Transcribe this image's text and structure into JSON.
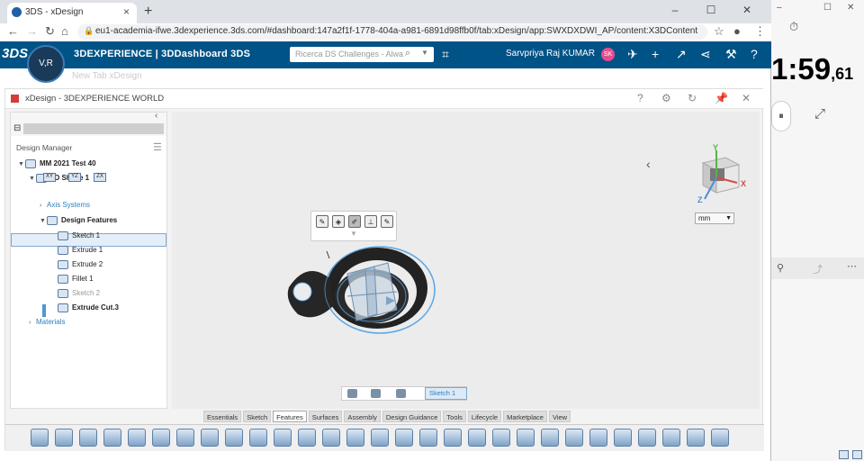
{
  "browser": {
    "tab_title": "3DS - xDesign",
    "tab_close": "×",
    "new_tab": "+",
    "url": "eu1-academia-ifwe.3dexperience.3ds.com/#dashboard:147a2f1f-1778-404a-a981-6891d98ffb0f/tab:xDesign/app:SWXDXDWI_AP/content:X3DContentId=%7B\"data\"%3A%7B\"i...",
    "window": {
      "minimize": "–",
      "maximize": "☐",
      "close": "✕"
    }
  },
  "dashboard": {
    "logo": "3DS",
    "title": "3DEXPERIENCE | 3DDashboard 3DS",
    "search_placeholder": "Ricerca DS Challenges - Always",
    "user_name": "Sarvpriya Raj KUMAR",
    "user_initials": "SK",
    "compass_label": "V,R"
  },
  "ghost_tabs": "New Tab     xDesign",
  "app": {
    "title": "xDesign - 3DEXPERIENCE WORLD"
  },
  "design_manager": {
    "label": "Design Manager",
    "tree": [
      {
        "label": "MM 2021 Test 40",
        "level": 0,
        "style": "bold"
      },
      {
        "label": "3D Shape 1",
        "level": 1,
        "style": "bold"
      },
      {
        "label": "Axis Systems",
        "level": 2,
        "style": "link"
      },
      {
        "label": "Design Features",
        "level": 2,
        "style": "bold"
      },
      {
        "label": "Sketch 1",
        "level": 3,
        "style": "normal"
      },
      {
        "label": "Extrude 1",
        "level": 3,
        "style": "normal"
      },
      {
        "label": "Extrude 2",
        "level": 3,
        "style": "normal"
      },
      {
        "label": "Fillet 1",
        "level": 3,
        "style": "normal"
      },
      {
        "label": "Sketch 2",
        "level": 3,
        "style": "dim"
      },
      {
        "label": "Extrude Cut.3",
        "level": 3,
        "style": "bold"
      },
      {
        "label": "Materials",
        "level": 1,
        "style": "link"
      }
    ]
  },
  "viewport": {
    "units": "mm",
    "axis_labels": {
      "x": "X",
      "y": "Y",
      "z": "Z"
    },
    "selection_chip": "Sketch 1"
  },
  "ribbon_tabs": [
    "Essentials",
    "Sketch",
    "Features",
    "Surfaces",
    "Assembly",
    "Design Guidance",
    "Tools",
    "Lifecycle",
    "Marketplace",
    "View"
  ],
  "active_ribbon_tab": "Features",
  "stopwatch": {
    "time": "1:59",
    "fraction": ",61"
  },
  "colors": {
    "ds_blue": "#005386",
    "accent": "#2d7fc0",
    "selection": "#e4eef8"
  }
}
